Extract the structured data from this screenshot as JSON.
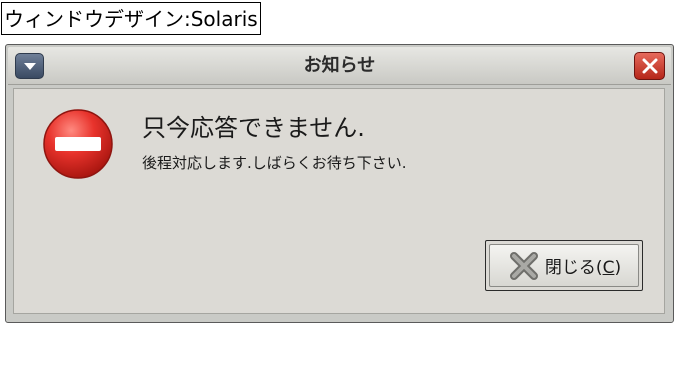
{
  "caption": "ウィンドウデザイン:Solaris",
  "window": {
    "title": "お知らせ"
  },
  "message": {
    "headline": "只今応答できません.",
    "detail": "後程対応します.しばらくお待ち下さい."
  },
  "buttons": {
    "close": {
      "label": "閉じる(",
      "mnemonic": "C",
      "suffix": ")"
    }
  },
  "icons": {
    "window_menu": "chevron-down-icon",
    "window_close": "close-icon",
    "message": "error-icon",
    "button": "close-x-icon"
  },
  "colors": {
    "error_red": "#e8332c",
    "close_button_red": "#c8382a",
    "content_background": "#dcdad5"
  }
}
